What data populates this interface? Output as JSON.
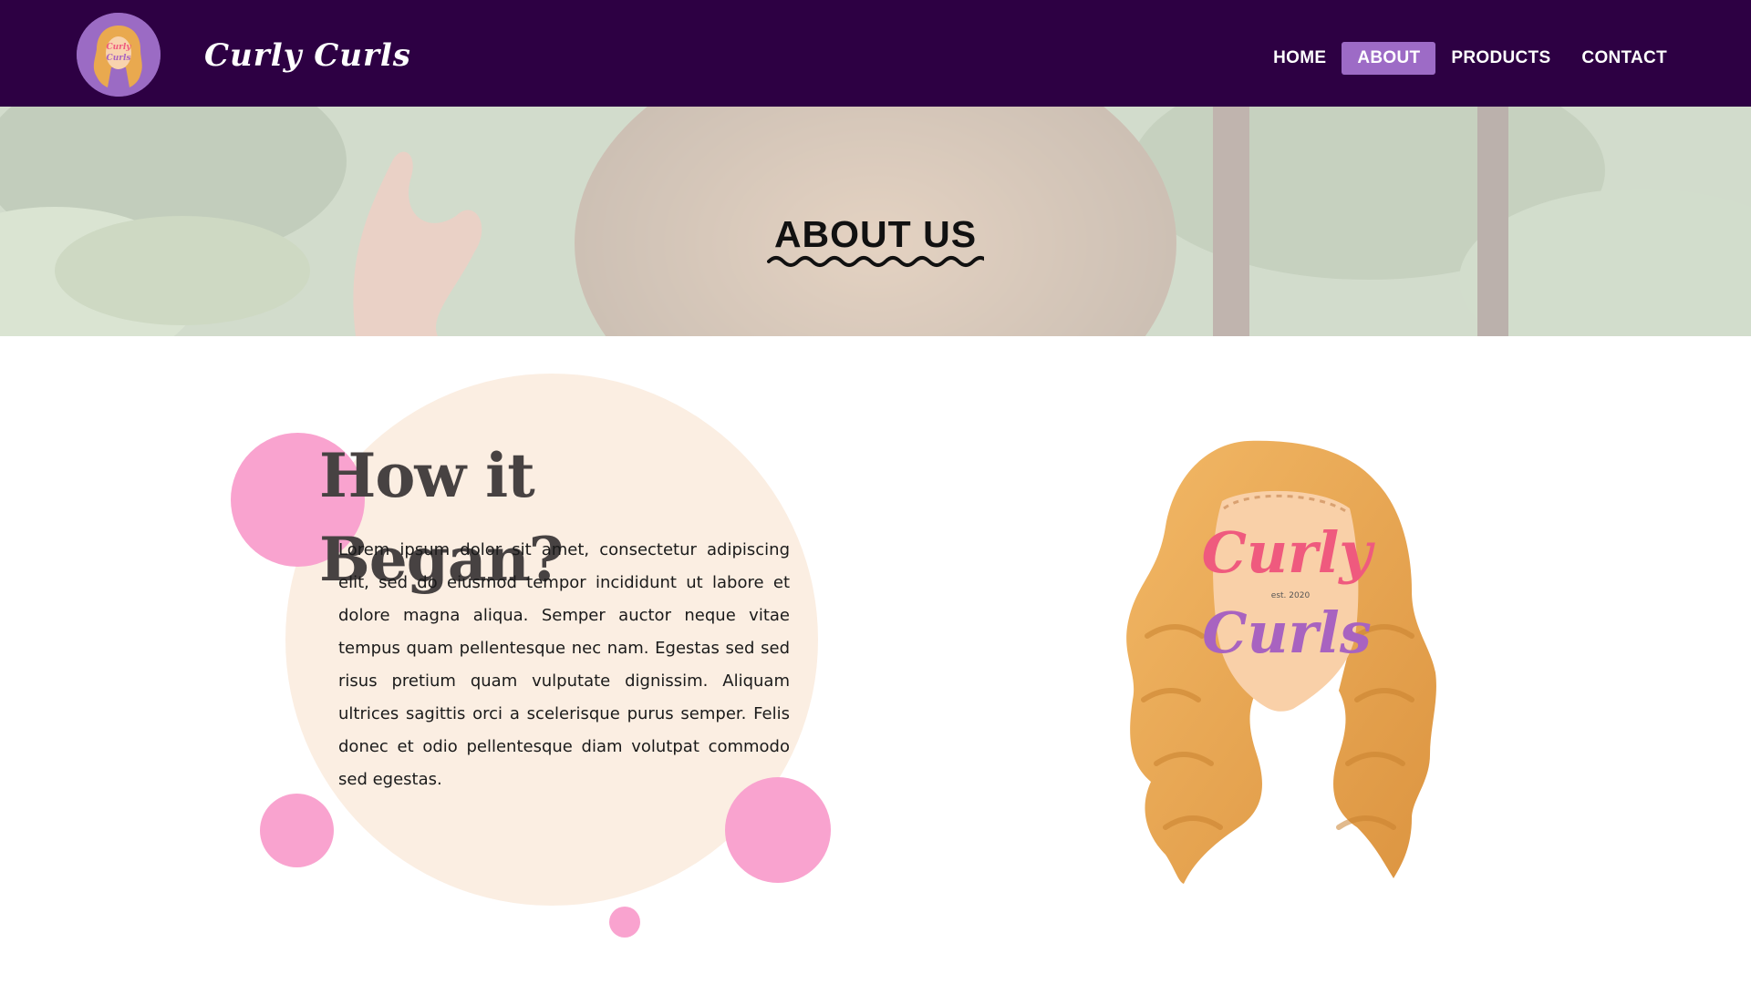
{
  "header": {
    "brand": "Curly Curls",
    "logo_icon": "wig-logo-icon",
    "nav": [
      {
        "label": "HOME",
        "active": false
      },
      {
        "label": "ABOUT",
        "active": true
      },
      {
        "label": "PRODUCTS",
        "active": false
      },
      {
        "label": "CONTACT",
        "active": false
      }
    ]
  },
  "hero": {
    "title": "ABOUT US"
  },
  "about": {
    "heading": "How it Began?",
    "body": "Lorem ipsum dolor sit amet, consectetur adipiscing elit, sed do eiusmod tempor incididunt ut labore et dolore magna aliqua. Semper auctor neque vitae tempus quam pellentesque nec nam. Egestas sed sed risus pretium quam vulputate dignissim. Aliquam ultrices sagittis orci a scelerisque purus semper. Felis donec et odio pellentesque diam volutpat commodo sed egestas."
  },
  "illustration": {
    "line1": "Curly",
    "tagline": "est. 2020",
    "line2": "Curls"
  },
  "colors": {
    "header_bg": "#2d0043",
    "nav_active_bg": "#9d6bc6",
    "circle_bg": "#fbeee2",
    "dot_pink": "#f9a3cf",
    "hair_orange": "#e9a94f",
    "logo_pink": "#ef5a7e",
    "logo_purple": "#a863c0"
  }
}
